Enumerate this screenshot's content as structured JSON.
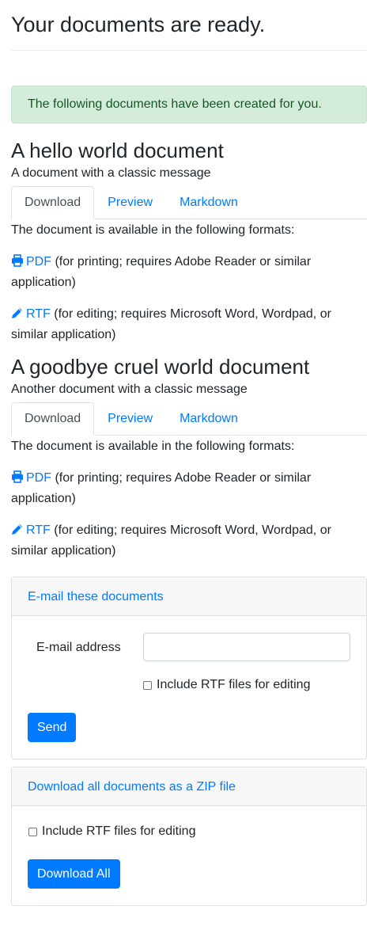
{
  "page": {
    "title": "Your documents are ready.",
    "alert": "The following documents have been created for you."
  },
  "documents": [
    {
      "title": "A hello world document",
      "description": "A document with a classic message",
      "tabs": [
        "Download",
        "Preview",
        "Markdown"
      ],
      "available_text": "The document is available in the following formats:",
      "formats": [
        {
          "icon": "printer-icon",
          "label": "PDF",
          "note": "(for printing; requires Adobe Reader or similar application)"
        },
        {
          "icon": "pencil-icon",
          "label": "RTF",
          "note": "(for editing; requires Microsoft Word, Wordpad, or similar application)"
        }
      ]
    },
    {
      "title": "A goodbye cruel world document",
      "description": "Another document with a classic message",
      "tabs": [
        "Download",
        "Preview",
        "Markdown"
      ],
      "available_text": "The document is available in the following formats:",
      "formats": [
        {
          "icon": "printer-icon",
          "label": "PDF",
          "note": "(for printing; requires Adobe Reader or similar application)"
        },
        {
          "icon": "pencil-icon",
          "label": "RTF",
          "note": "(for editing; requires Microsoft Word, Wordpad, or similar application)"
        }
      ]
    }
  ],
  "email": {
    "header": "E-mail these documents",
    "label": "E-mail address",
    "value": "",
    "checkbox_label": "Include RTF files for editing",
    "button": "Send"
  },
  "zip": {
    "header": "Download all documents as a ZIP file",
    "checkbox_label": "Include RTF files for editing",
    "button": "Download All"
  },
  "colors": {
    "link": "#007bff",
    "alert_bg": "#d4edda",
    "alert_text": "#155724",
    "button_bg": "#007bff"
  }
}
